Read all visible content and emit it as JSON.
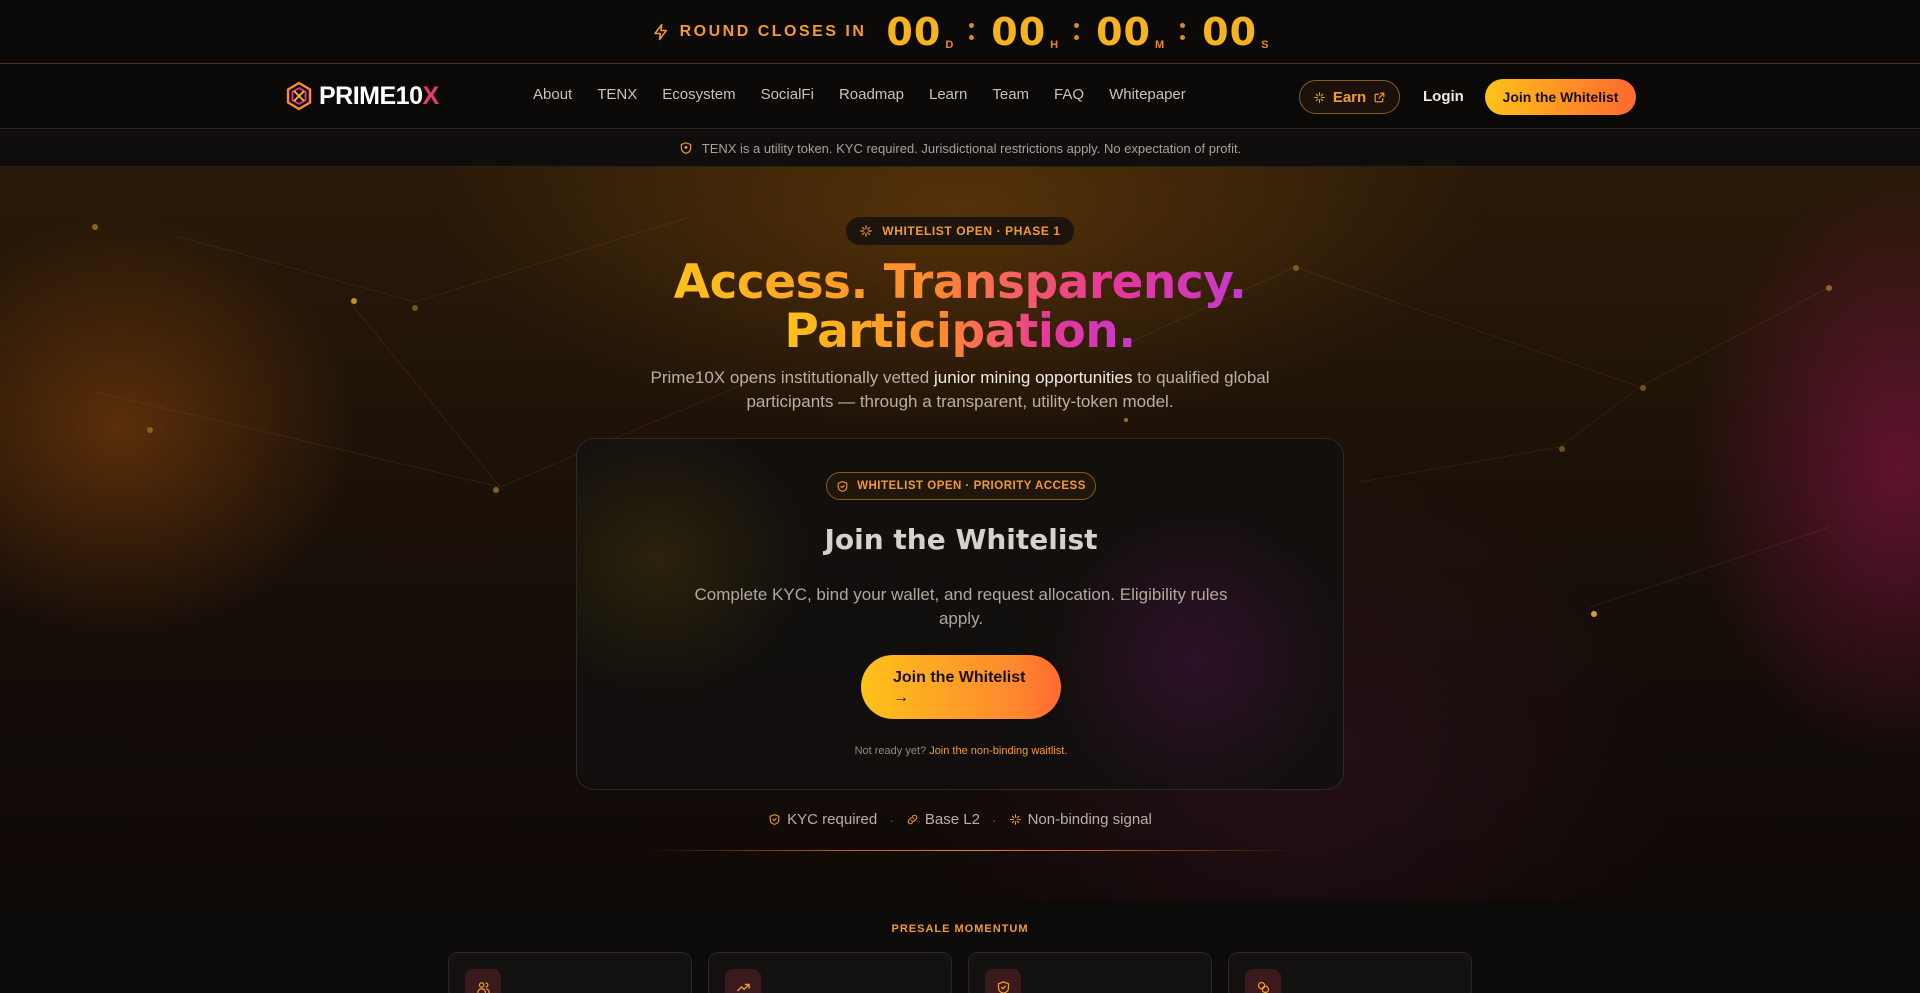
{
  "countdown": {
    "label": "ROUND CLOSES IN",
    "units": [
      {
        "value": "00",
        "suffix": "D"
      },
      {
        "value": "00",
        "suffix": "H"
      },
      {
        "value": "00",
        "suffix": "M"
      },
      {
        "value": "00",
        "suffix": "S"
      }
    ]
  },
  "nav": {
    "logo_main": "PRIME10",
    "logo_x": "X",
    "links": [
      "About",
      "TENX",
      "Ecosystem",
      "SocialFi",
      "Roadmap",
      "Learn",
      "Team",
      "FAQ",
      "Whitepaper"
    ],
    "earn_label": "Earn",
    "login_label": "Login",
    "cta_label": "Join the Whitelist"
  },
  "disclaimer": "TENX is a utility token. KYC required. Jurisdictional restrictions apply. No expectation of profit.",
  "hero": {
    "pill": "WHITELIST OPEN · PHASE 1",
    "headline_line1": "Access. Transparency.",
    "headline_line2": "Participation.",
    "sub_part1": "Prime10X opens institutionally vetted ",
    "sub_highlight": "junior mining opportunities",
    "sub_part2": " to qualified global participants — through a transparent, utility-token model."
  },
  "card": {
    "badge": "WHITELIST OPEN · PRIORITY ACCESS",
    "title": "Join the Whitelist",
    "description": "Complete KYC, bind your wallet, and request allocation. Eligibility rules apply.",
    "cta_label": "Join the Whitelist",
    "cta_arrow": "→",
    "note_prefix": "Not ready yet? ",
    "note_link": "Join the non-binding waitlist."
  },
  "trust": {
    "items": [
      "KYC required",
      "Base L2",
      "Non-binding signal"
    ],
    "separator": "·"
  },
  "momentum": {
    "label": "PRESALE MOMENTUM",
    "icons": [
      "users-icon",
      "trending-up-icon",
      "shield-check-icon",
      "coins-icon"
    ]
  },
  "colors": {
    "accent": "#f29a2e",
    "gold": "#ffc21a",
    "magenta": "#e8389a"
  }
}
